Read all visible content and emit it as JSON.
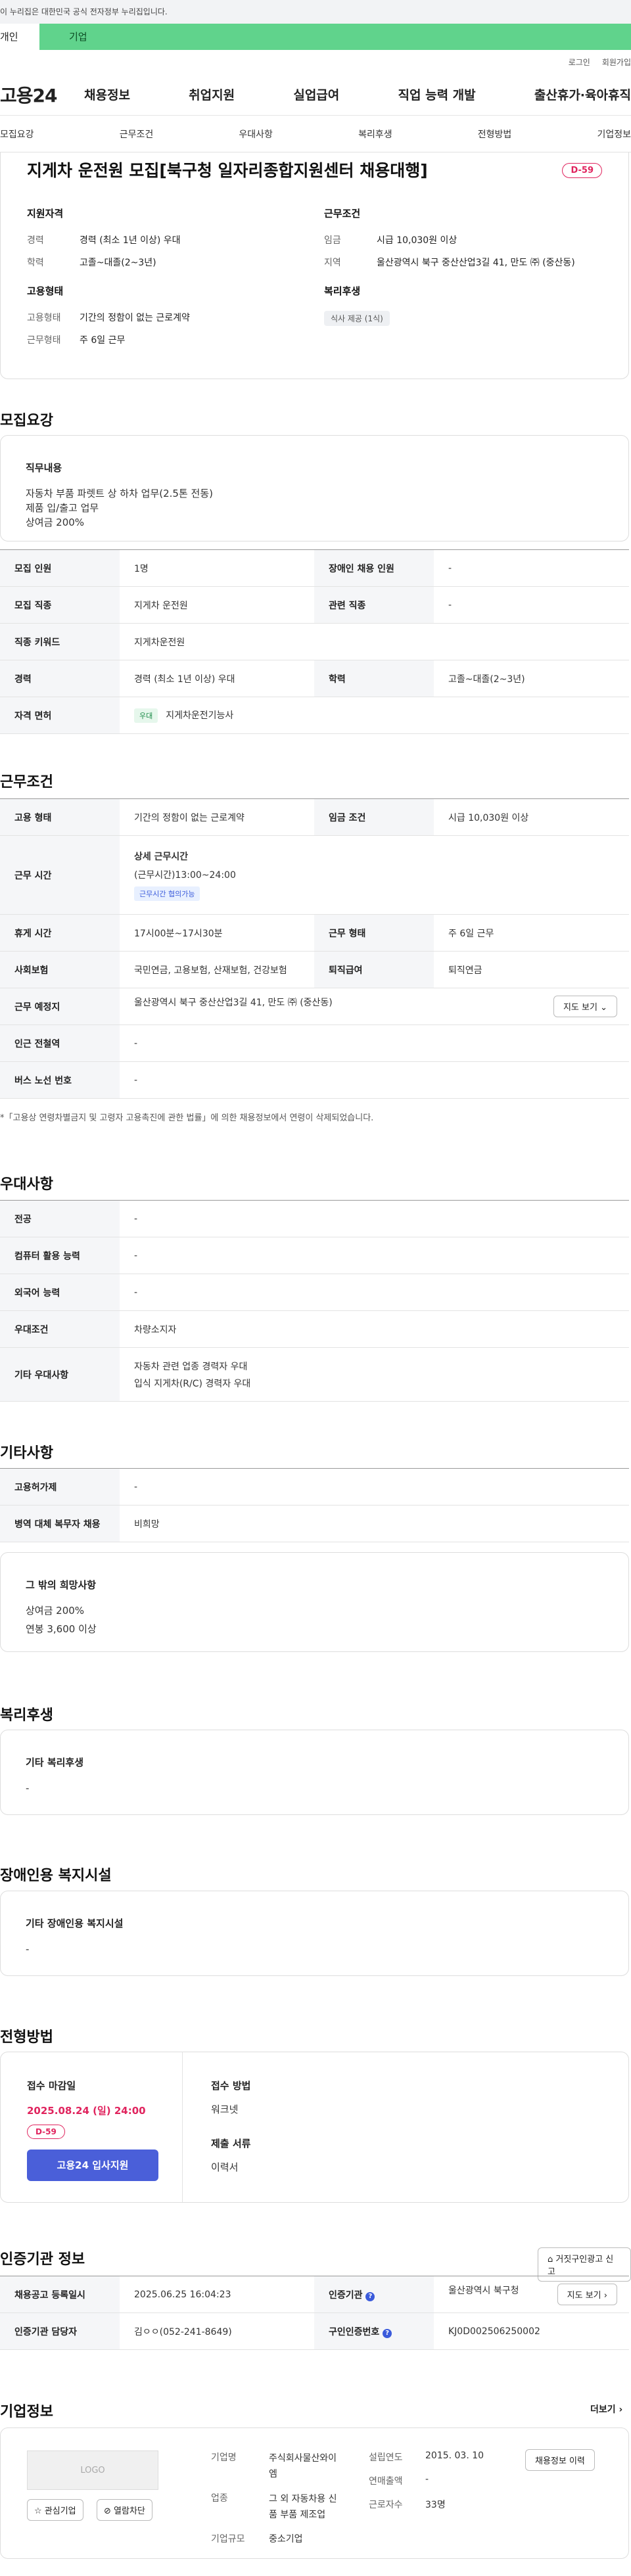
{
  "top_notice": "이 누리집은 대한민국 공식 전자정부 누리집입니다.",
  "type_tabs": [
    "개인",
    "기업"
  ],
  "util_links": [
    "로그인",
    "회원가입"
  ],
  "logo": "고용24",
  "gnb": [
    "채용정보",
    "취업지원",
    "실업급여",
    "직업 능력 개발",
    "출산휴가·육아휴직"
  ],
  "tabs": [
    "모집요강",
    "근무조건",
    "우대사항",
    "복리후생",
    "전형방법",
    "기업정보"
  ],
  "job": {
    "title": "지게차 운전원 모집[북구청 일자리종합지원센터 채용대행]",
    "dday": "D-59",
    "qual_head": "지원자격",
    "qual": [
      {
        "k": "경력",
        "v": "경력 (최소 1년 이상) 우대"
      },
      {
        "k": "학력",
        "v": "고졸~대졸(2~3년)"
      }
    ],
    "work_head": "근무조건",
    "work": [
      {
        "k": "임금",
        "v": "시급 10,030원 이상"
      },
      {
        "k": "지역",
        "v": "울산광역시 북구 중산산업3길 41, 만도 ㈜ (중산동)"
      }
    ],
    "emp_head": "고용형태",
    "emp": [
      {
        "k": "고용형태",
        "v": "기간의 정함이 없는 근로계약"
      },
      {
        "k": "근무형태",
        "v": "주 6일 근무"
      }
    ],
    "welfare_head": "복리후생",
    "welfare_chip": "식사 제공 (1식)"
  },
  "recruit": {
    "title": "모집요강",
    "duty_head": "직무내용",
    "duty_lines": [
      "자동차 부품 파렛트 상 하차 업무(2.5톤 전동)",
      "제품 입/출고 업무",
      "상여금 200%"
    ],
    "rows": [
      {
        "k1": "모집 인원",
        "v1": "1명",
        "k2": "장애인 채용 인원",
        "v2": "-"
      },
      {
        "k1": "모집 직종",
        "v1": "지게차 운전원",
        "k2": "관련 직종",
        "v2": "-"
      },
      {
        "k1": "직종 키워드",
        "v1": "지게차운전원"
      },
      {
        "k1": "경력",
        "v1": "경력 (최소 1년 이상) 우대",
        "k2": "학력",
        "v2": "고졸~대졸(2~3년)"
      }
    ],
    "license_k": "자격 면허",
    "license_badge": "우대",
    "license_v": "지게차운전기능사"
  },
  "workcond": {
    "title": "근무조건",
    "emp_k": "고용 형태",
    "emp_v": "기간의 정함이 없는 근로계약",
    "wage_k": "임금 조건",
    "wage_v": "시급 10,030원 이상",
    "time_k": "근무 시간",
    "time_head": "상세 근무시간",
    "time_v": "(근무시간)13:00~24:00",
    "time_badge": "근무시간 협의가능",
    "rest_k": "휴게 시간",
    "rest_v": "17시00분~17시30분",
    "shift_k": "근무 형태",
    "shift_v": "주 6일 근무",
    "ins_k": "사회보험",
    "ins_v": "국민연금, 고용보험, 산재보험, 건강보험",
    "ret_k": "퇴직급여",
    "ret_v": "퇴직연금",
    "place_k": "근무 예정지",
    "place_v": "울산광역시 북구 중산산업3길 41, 만도 ㈜ (중산동)",
    "map_btn": "지도 보기",
    "subway_k": "인근 전철역",
    "subway_v": "-",
    "bus_k": "버스 노선 번호",
    "bus_v": "-",
    "note": "*「고용상 연령차별금지 및 고령자 고용촉진에 관한 법률」에 의한 채용정보에서 연령이 삭제되었습니다."
  },
  "pref": {
    "title": "우대사항",
    "rows": [
      {
        "k": "전공",
        "v": "-"
      },
      {
        "k": "컴퓨터 활용 능력",
        "v": "-"
      },
      {
        "k": "외국어 능력",
        "v": "-"
      },
      {
        "k": "우대조건",
        "v": "차량소지자"
      }
    ],
    "etc_k": "기타 우대사항",
    "etc_lines": [
      "자동차 관련 업종 경력자 우대",
      "입식 지게차(R/C) 경력자 우대"
    ]
  },
  "other": {
    "title": "기타사항",
    "rows": [
      {
        "k": "고용허가제",
        "v": "-"
      },
      {
        "k": "병역 대체 복무자 채용",
        "v": "비희망"
      }
    ],
    "hope_head": "그 밖의 희망사항",
    "hope_lines": [
      "상여금 200%",
      "연봉 3,600 이상"
    ]
  },
  "welfare": {
    "title": "복리후생",
    "head": "기타 복리후생",
    "v": "-"
  },
  "disab": {
    "title": "장애인용 복지시설",
    "head": "기타 장애인용 복지시설",
    "v": "-"
  },
  "process": {
    "title": "전형방법",
    "deadline_k": "접수 마감일",
    "deadline_v": "2025.08.24 (일) 24:00",
    "dday": "D-59",
    "apply_btn": "고용24 입사지원",
    "method_k": "접수 방법",
    "method_v": "워크넷",
    "docs_k": "제출 서류",
    "docs_v": "이력서"
  },
  "cert": {
    "title": "인증기관 정보",
    "report_btn": "거짓구인광고 신고",
    "reg_k": "채용공고 등록일시",
    "reg_v": "2025.06.25 16:04:23",
    "org_k": "인증기관",
    "org_v": "울산광역시 북구청",
    "map_btn": "지도 보기",
    "mgr_k": "인증기관 담당자",
    "mgr_v": "김ㅇㅇ(052-241-8649)",
    "num_k": "구인인증번호",
    "num_v": "KJ0D002506250002"
  },
  "company": {
    "title": "기업정보",
    "more": "더보기",
    "logo": "LOGO",
    "fav_btn": "관심기업",
    "block_btn": "열람차단",
    "name_k": "기업명",
    "name_v": [
      "주식회사물산와이",
      "엠"
    ],
    "ind_k": "업종",
    "ind_v": [
      "그 외 자동차용 신",
      "품 부품 제조업"
    ],
    "size_k": "기업규모",
    "size_v": "중소기업",
    "year_k": "설립연도",
    "year_v": "2015. 03. 10",
    "sales_k": "연매출액",
    "sales_v": "-",
    "emp_k": "근로자수",
    "emp_v": "33명",
    "history_btn": "채용정보 이력"
  }
}
